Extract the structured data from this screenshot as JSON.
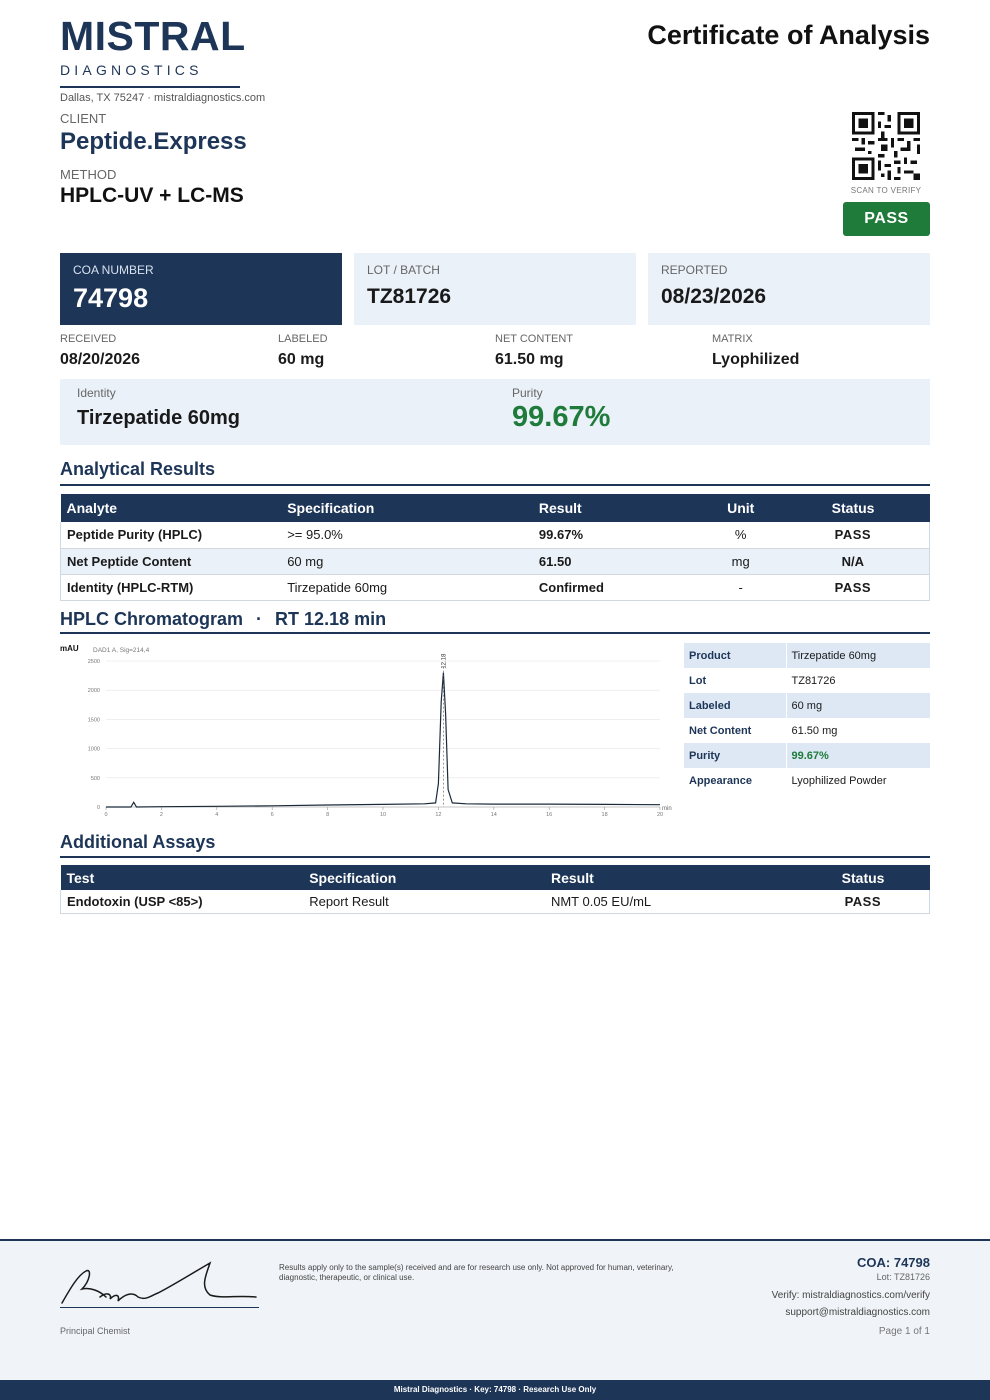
{
  "header": {
    "brand_name": "MISTRAL",
    "brand_sub": "DIAGNOSTICS",
    "address": "Dallas, TX 75247  ·  mistraldiagnostics.com",
    "title": "Certificate of Analysis",
    "client_label": "CLIENT",
    "client_name": "Peptide.Express",
    "method_label": "METHOD",
    "method_value": "HPLC-UV + LC-MS",
    "scan_label": "SCAN TO VERIFY",
    "status_badge": "PASS"
  },
  "cards": [
    {
      "label": "COA NUMBER",
      "value": "74798"
    },
    {
      "label": "LOT / BATCH",
      "value": "TZ81726"
    },
    {
      "label": "REPORTED",
      "value": "08/23/2026"
    }
  ],
  "meta": [
    {
      "label": "RECEIVED",
      "value": "08/20/2026"
    },
    {
      "label": "LABELED",
      "value": "60 mg"
    },
    {
      "label": "NET CONTENT",
      "value": "61.50 mg"
    },
    {
      "label": "MATRIX",
      "value": "Lyophilized"
    }
  ],
  "identity": {
    "identity_label": "Identity",
    "identity_value": "Tirzepatide 60mg",
    "purity_label": "Purity",
    "purity_value": "99.67%"
  },
  "analytical": {
    "title": "Analytical Results",
    "headers": [
      "Analyte",
      "Specification",
      "Result",
      "Unit",
      "Status"
    ],
    "rows": [
      [
        "Peptide Purity (HPLC)",
        ">= 95.0%",
        "99.67%",
        "%",
        "PASS"
      ],
      [
        "Net Peptide Content",
        "60 mg",
        "61.50",
        "mg",
        "N/A"
      ],
      [
        "Identity (HPLC-RTM)",
        "Tirzepatide 60mg",
        "Confirmed",
        "-",
        "PASS"
      ]
    ]
  },
  "chromatogram": {
    "title": "HPLC Chromatogram",
    "separator": "·",
    "rt": "RT 12.18 min",
    "y_unit": "mAU",
    "signal": "DAD1 A, Sig=214,4",
    "x_unit": "min",
    "peak_label": "12.18"
  },
  "chart_data": {
    "type": "line",
    "title": "HPLC Chromatogram",
    "xlabel": "min",
    "ylabel": "mAU",
    "xlim": [
      0,
      20
    ],
    "ylim": [
      0,
      2500
    ],
    "x_ticks": [
      0,
      2,
      4,
      6,
      8,
      10,
      12,
      14,
      16,
      18,
      20
    ],
    "y_ticks": [
      0,
      500,
      1000,
      1500,
      2000,
      2500
    ],
    "grid": true,
    "annotations": [
      {
        "x": 12.18,
        "text": "12.18"
      }
    ],
    "series": [
      {
        "x": [
          0,
          0.9,
          1.0,
          1.1,
          2,
          4,
          6,
          8,
          10,
          11.5,
          11.9,
          12.0,
          12.1,
          12.18,
          12.26,
          12.35,
          12.5,
          13,
          14,
          16,
          18,
          20
        ],
        "y": [
          0,
          0,
          80,
          0,
          5,
          12,
          20,
          35,
          45,
          55,
          70,
          400,
          1800,
          2300,
          1600,
          300,
          70,
          55,
          50,
          50,
          45,
          40
        ]
      }
    ]
  },
  "product_info": [
    {
      "label": "Product",
      "value": "Tirzepatide 60mg"
    },
    {
      "label": "Lot",
      "value": "TZ81726"
    },
    {
      "label": "Labeled",
      "value": "60 mg"
    },
    {
      "label": "Net Content",
      "value": "61.50 mg"
    },
    {
      "label": "Purity",
      "value": "99.67%"
    },
    {
      "label": "Appearance",
      "value": "Lyophilized Powder"
    }
  ],
  "additional": {
    "title": "Additional Assays",
    "headers": [
      "Test",
      "Specification",
      "Result",
      "Status"
    ],
    "rows": [
      [
        "Endotoxin (USP <85>)",
        "Report Result",
        "NMT 0.05 EU/mL",
        "PASS"
      ]
    ]
  },
  "footer": {
    "signature_label": "Principal Chemist",
    "disclaimer": "Results apply only to the sample(s) received and are for research use only. Not approved for human, veterinary, diagnostic, therapeutic, or clinical use.",
    "coa": "COA: 74798",
    "lot": "Lot: TZ81726",
    "verify": "Verify: mistraldiagnostics.com/verify",
    "support": "support@mistraldiagnostics.com",
    "page": "Page 1 of 1",
    "bar": "Mistral Diagnostics  ·  Key: 74798  ·  Research Use Only"
  },
  "colors": {
    "navy": "#1d3557",
    "pass_green": "#1e7b3a",
    "light_blue": "#eaf1f9"
  }
}
